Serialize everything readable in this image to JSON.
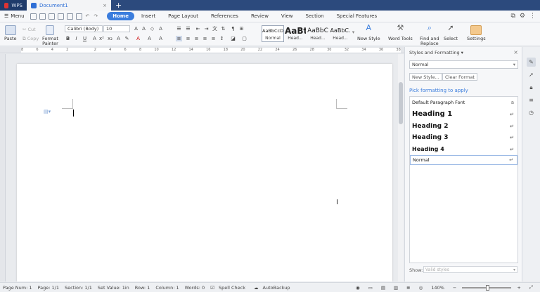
{
  "titlebar": {
    "app_tab": "WPS",
    "doc_tab": "Document1",
    "new_tab": "+"
  },
  "menubar": {
    "menu_label": "Menu",
    "tabs": [
      "Home",
      "Insert",
      "Page Layout",
      "References",
      "Review",
      "View",
      "Section",
      "Special Features"
    ],
    "active_tab": "Home"
  },
  "ribbon": {
    "paste": "Paste",
    "cut": "Cut",
    "copy": "Copy",
    "format_painter_1": "Format",
    "format_painter_2": "Painter",
    "font_name": "Calibri (Body)",
    "font_size": "10",
    "styles": [
      {
        "preview": "AaBbCcDd",
        "name": "Normal"
      },
      {
        "preview": "AaBt",
        "name": "Head..."
      },
      {
        "preview": "AaBbC",
        "name": "Head..."
      },
      {
        "preview": "AaBbC.",
        "name": "Head..."
      }
    ],
    "new_style": "New Style",
    "word_tools": "Word Tools",
    "find_replace_1": "Find and",
    "find_replace_2": "Replace",
    "select": "Select",
    "settings": "Settings"
  },
  "ruler_numbers": [
    "8",
    "6",
    "4",
    "2",
    "",
    "2",
    "4",
    "6",
    "8",
    "10",
    "12",
    "14",
    "16",
    "18",
    "20",
    "22",
    "24",
    "26",
    "28",
    "30",
    "32",
    "34",
    "36",
    "38"
  ],
  "panel": {
    "title": "Styles and Formatting",
    "current_style": "Normal",
    "new_style_btn": "New Style...",
    "clear_format_btn": "Clear Format",
    "pick_label": "Pick formatting to apply",
    "items": [
      "Default Paragraph Font",
      "Heading 1",
      "Heading 2",
      "Heading 3",
      "Heading 4",
      "Normal"
    ],
    "show_label": "Show:",
    "show_value": "Valid styles"
  },
  "status": {
    "page_num": "Page Num: 1",
    "page": "Page: 1/1",
    "section": "Section: 1/1",
    "set_value": "Set Value: 1in",
    "row": "Row: 1",
    "column": "Column: 1",
    "words": "Words: 0",
    "spell_check": "Spell Check",
    "autobackup": "AutoBackup",
    "zoom": "140%"
  }
}
